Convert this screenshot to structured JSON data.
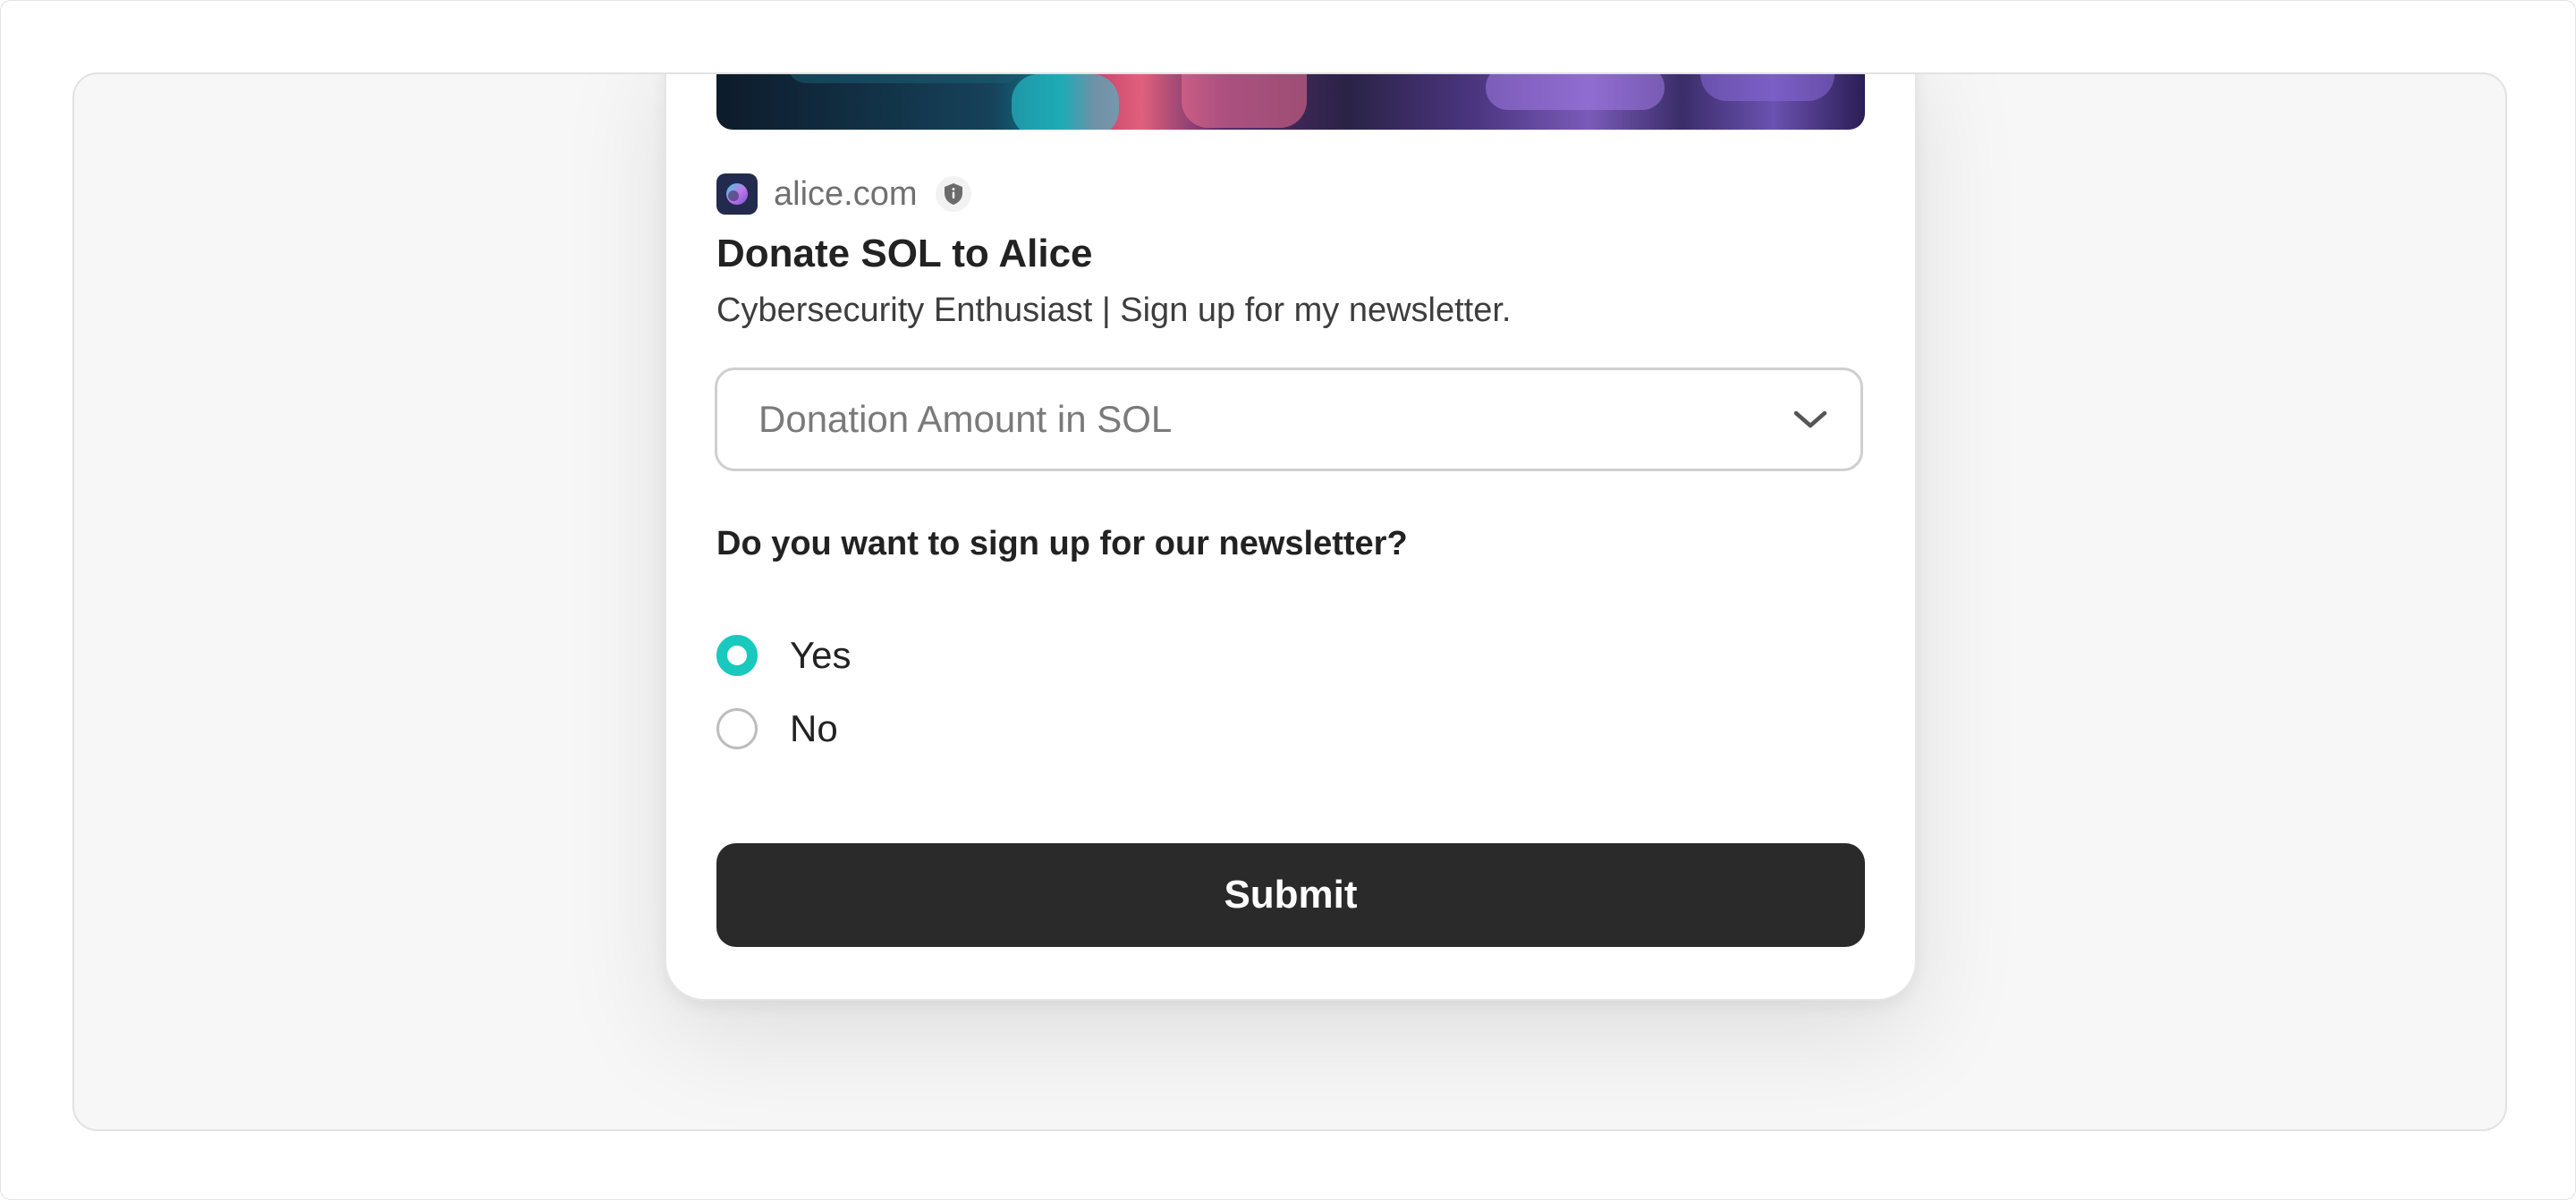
{
  "site": {
    "logo_icon": "alice-logo-icon",
    "domain": "alice.com",
    "badge_icon": "shield-info-icon"
  },
  "action": {
    "title": "Donate SOL to Alice",
    "description": "Cybersecurity Enthusiast | Sign up for my newsletter."
  },
  "donation_select": {
    "placeholder": "Donation Amount in SOL",
    "icon": "chevron-down-icon"
  },
  "newsletter": {
    "question": "Do you want to sign up for our newsletter?",
    "options": [
      {
        "label": "Yes",
        "selected": true
      },
      {
        "label": "No",
        "selected": false
      }
    ]
  },
  "submit": {
    "label": "Submit"
  },
  "colors": {
    "accent": "#19c9bd",
    "button_bg": "#2a2a2a",
    "logo_bg": "#222a4e"
  }
}
